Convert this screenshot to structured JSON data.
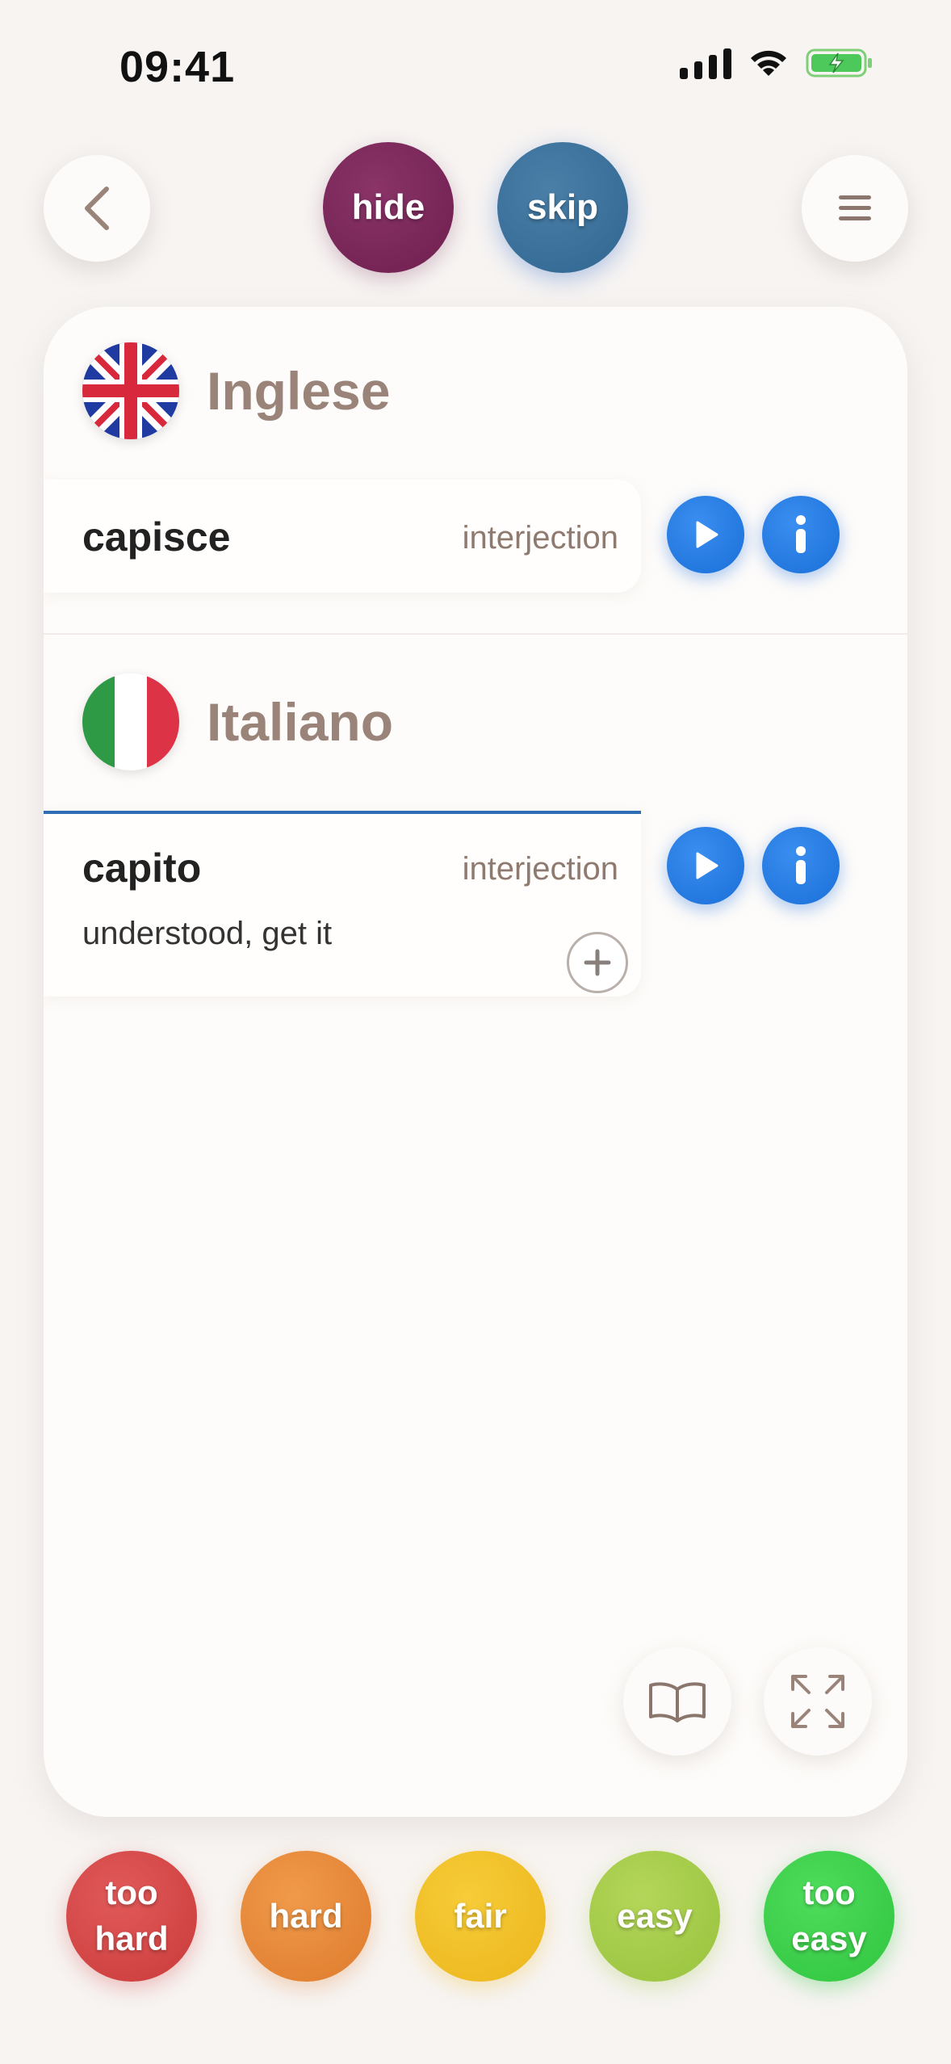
{
  "status_bar": {
    "time": "09:41"
  },
  "header": {
    "hide_label": "hide",
    "skip_label": "skip"
  },
  "source_language": {
    "name": "Inglese",
    "flag": "uk-flag",
    "word": "capisce",
    "part_of_speech": "interjection"
  },
  "target_language": {
    "name": "Italiano",
    "flag": "italy-flag",
    "word": "capito",
    "part_of_speech": "interjection",
    "meaning": "understood, get it"
  },
  "rating": {
    "too_hard_line1": "too",
    "too_hard_line2": "hard",
    "hard": "hard",
    "fair": "fair",
    "easy": "easy",
    "too_easy_line1": "too",
    "too_easy_line2": "easy"
  },
  "colors": {
    "accent_blue": "#1a6fd8",
    "hide": "#6e1e4e",
    "skip": "#2f6690",
    "too_hard": "#c93a3a",
    "hard": "#de7a2c",
    "fair": "#ecb51c",
    "easy": "#97c23c",
    "too_easy": "#2fc53e"
  },
  "icons": [
    "back-chevron-icon",
    "menu-icon",
    "play-icon",
    "info-icon",
    "plus-icon",
    "book-icon",
    "expand-icon",
    "signal-icon",
    "wifi-icon",
    "battery-charging-icon"
  ]
}
